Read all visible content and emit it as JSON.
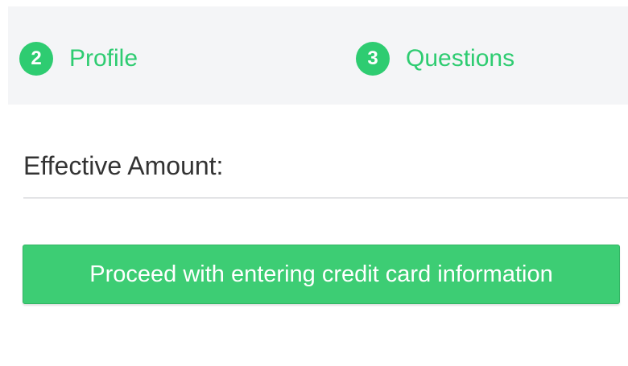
{
  "steps": [
    {
      "number": "2",
      "label": "Profile"
    },
    {
      "number": "3",
      "label": "Questions"
    }
  ],
  "form": {
    "amount_label": "Effective Amount:"
  },
  "actions": {
    "proceed_label": "Proceed with entering credit card information"
  },
  "colors": {
    "accent": "#2ecc71",
    "button": "#3dcd74",
    "stepper_bg": "#f4f5f7",
    "text": "#333333"
  }
}
